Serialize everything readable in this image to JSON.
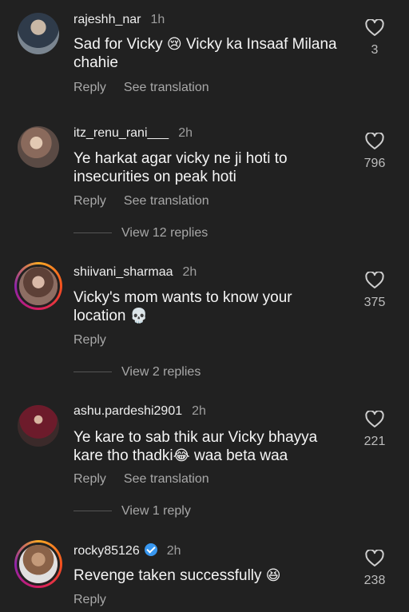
{
  "comments": [
    {
      "username": "rajeshh_nar",
      "time": "1h",
      "text": "Sad for Vicky",
      "emoji": "😢",
      "text2": "Vicky ka Insaaf Milana chahie",
      "reply": "Reply",
      "translate": "See translation",
      "likes": "3"
    },
    {
      "username": "itz_renu_rani___",
      "time": "2h",
      "text": "Ye harkat agar vicky ne ji hoti to insecurities on peak hoti",
      "reply": "Reply",
      "translate": "See translation",
      "likes": "796",
      "view_replies": "View 12 replies"
    },
    {
      "username": "shiivani_sharmaa",
      "time": "2h",
      "text": "Vicky's mom wants to know your location",
      "emoji": "💀",
      "reply": "Reply",
      "likes": "375",
      "view_replies": "View 2 replies"
    },
    {
      "username": "ashu.pardeshi2901",
      "time": "2h",
      "text": "Ye kare to sab thik aur Vicky bhayya kare tho thadki",
      "emoji": "😂",
      "text2": "waa beta waa",
      "reply": "Reply",
      "translate": "See translation",
      "likes": "221",
      "view_replies": "View 1 reply"
    },
    {
      "username": "rocky85126",
      "time": "2h",
      "text": "Revenge taken successfully",
      "emoji": "😆",
      "reply": "Reply",
      "likes": "238",
      "verified": true
    }
  ],
  "colors": {
    "background": "#212121",
    "verified": "#3897f0",
    "story_ring": "#d81b60"
  },
  "icons": {
    "like": "heart-outline-icon",
    "verified": "verified-badge-icon"
  }
}
